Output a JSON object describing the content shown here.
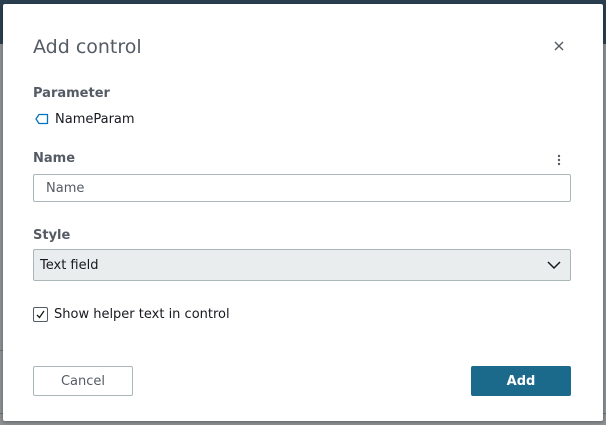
{
  "dialog": {
    "title": "Add control",
    "close_icon": "close-icon",
    "parameter": {
      "label": "Parameter",
      "icon": "tag-icon",
      "name": "NameParam"
    },
    "name_field": {
      "label": "Name",
      "placeholder": "Name",
      "value": "",
      "menu_icon": "kebab-menu-icon"
    },
    "style_field": {
      "label": "Style",
      "selected": "Text field",
      "chevron_icon": "chevron-down-icon"
    },
    "helper_checkbox": {
      "label": "Show helper text in control",
      "checked": true
    },
    "buttons": {
      "cancel": "Cancel",
      "add": "Add"
    }
  },
  "colors": {
    "primary_button": "#1b6a8b",
    "tag_icon": "#0073bb",
    "label_text": "#545b64",
    "overlay": "#8f9294"
  }
}
